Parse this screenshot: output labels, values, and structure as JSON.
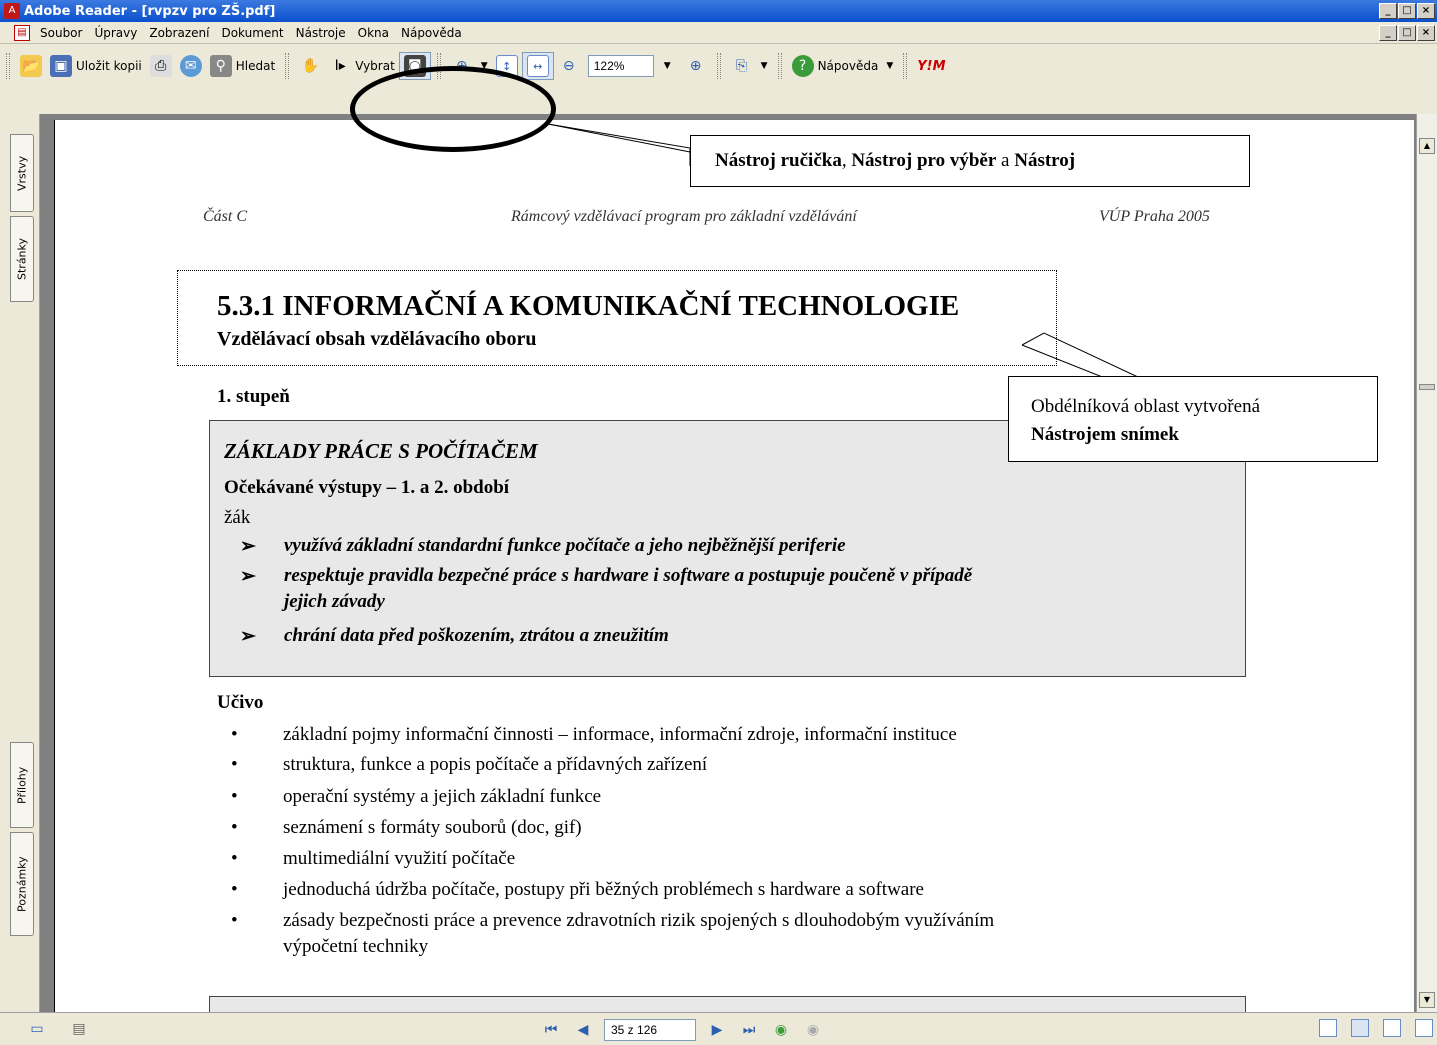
{
  "window": {
    "title": "Adobe Reader - [rvpzv pro ZŠ.pdf]",
    "app_icon_glyph": "A",
    "buttons": [
      "_",
      "□",
      "×"
    ]
  },
  "menu": {
    "items": [
      "Soubor",
      "Úpravy",
      "Zobrazení",
      "Dokument",
      "Nástroje",
      "Okna",
      "Nápověda"
    ]
  },
  "toolbar": {
    "save_copy_label": "Uložit kopii",
    "search_label": "Hledat",
    "select_label": "Vybrat",
    "zoom_value": "122%",
    "help_label": "Nápověda",
    "brand_label": "Y!M"
  },
  "sidebar": {
    "tabs": [
      "Vrstvy",
      "Stránky",
      "Přílohy",
      "Poznámky"
    ]
  },
  "document": {
    "header_left": "Část C",
    "header_center": "Rámcový vzdělávací program pro základní vzdělávání",
    "header_right": "VÚP Praha 2005",
    "heading": "5.3.1  INFORMAČNÍ A KOMUNIKAČNÍ TECHNOLOGIE",
    "subheading": "Vzdělávací obsah vzdělávacího oboru",
    "stupen": "1. stupeň",
    "box_title": "ZÁKLADY PRÁCE S POČÍTAČEM",
    "box_subtitle": "Očekávané výstupy – 1. a 2. období",
    "box_pupil": "žák",
    "box_items": [
      "využívá základní standardní funkce počítače a jeho nejběžnější  periferie",
      "respektuje pravidla bezpečné práce s hardware i software a  postupuje poučeně v případě",
      "jejich závady",
      "chrání data před poškozením, ztrátou a zneužitím"
    ],
    "ucivo_label": "Učivo",
    "ucivo_items": [
      "základní pojmy informační činnosti – informace, informační zdroje, informační instituce",
      "struktura, funkce a popis počítače a přídavných zařízení",
      "operační systémy a jejich základní funkce",
      "seznámení s formáty souborů (doc, gif)",
      "multimediální využití počítače",
      "jednoduchá údržba počítače, postupy při běžných problémech s hardware a software",
      "zásady bezpečnosti práce a prevence zdravotních rizik spojených s dlouhodobým využíváním",
      "výpočetní techniky"
    ]
  },
  "callouts": {
    "tools_part1": "Nástroj ručička",
    "tools_sep1": ", ",
    "tools_part2": "Nástroj pro výběr",
    "tools_sep2": " a ",
    "tools_part3": "Nástroj",
    "snapshot_line1": "Obdélníková oblast vytvořená",
    "snapshot_line2": "Nástrojem snímek"
  },
  "statusbar": {
    "page_indicator": "35 z 126"
  },
  "colors": {
    "titlebar": "#0a4fcd",
    "chrome": "#ece9d8",
    "box_fill": "#e8e8e8"
  }
}
